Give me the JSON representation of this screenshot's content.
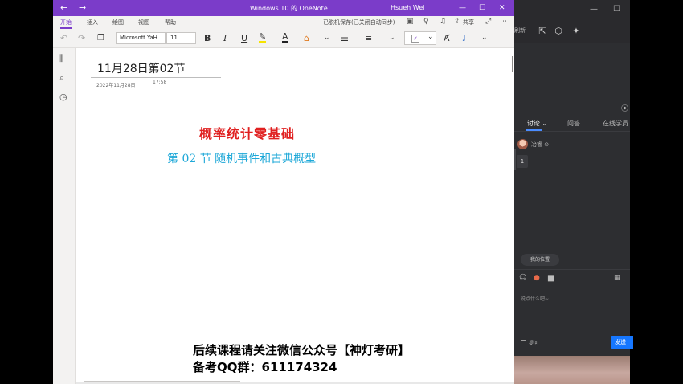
{
  "onenote": {
    "window_title": "Windows 10 的 OneNote",
    "user": "Hsueh Wei",
    "nav_back": "←",
    "nav_forward": "→",
    "win_buttons": [
      "—",
      "☐",
      "✕"
    ],
    "ribbon_tabs": [
      "开始",
      "插入",
      "绘图",
      "视图",
      "帮助"
    ],
    "sync_status": "已脱机保存(已关闭自动同步)",
    "share_label": "共享",
    "font_name": "Microsoft YaH",
    "font_size": "11",
    "toolbar_icons": {
      "undo": "↶",
      "redo": "↷",
      "clipboard": "📋",
      "bold": "B",
      "italic": "I",
      "underline": "U",
      "highlight": "✎",
      "font_color": "A",
      "format_painter": "🖌",
      "chevron": "⌄",
      "bullets": "☰",
      "numbering": "≡",
      "tag_check": "✓",
      "text_style": "A̸",
      "dictate": "🎙"
    },
    "left_nav_icons": [
      "⫼",
      "⌕",
      "◷"
    ],
    "page": {
      "title": "11月28日第02节",
      "date": "2022年11月28日",
      "time": "17:58",
      "heading_red": "概率统计零基础",
      "heading_blue": "第 02 节  随机事件和古典概型",
      "footer_line1": "后续课程请关注微信公众号【神灯考研】",
      "footer_line2": "备考QQ群：611174324"
    }
  },
  "chat": {
    "top_label": "刷新",
    "win_buttons": [
      "—",
      "☐"
    ],
    "tabs": [
      "讨论 ⌄",
      "问答",
      "在线学员"
    ],
    "user_name": "冶睿",
    "message_count": "1",
    "location_button": "我的位置",
    "input_placeholder": "说点什么吧~",
    "anonymous_label": "提问",
    "send_label": "发送",
    "tool_icons": [
      "☺",
      "●",
      "▆",
      "▦"
    ]
  }
}
